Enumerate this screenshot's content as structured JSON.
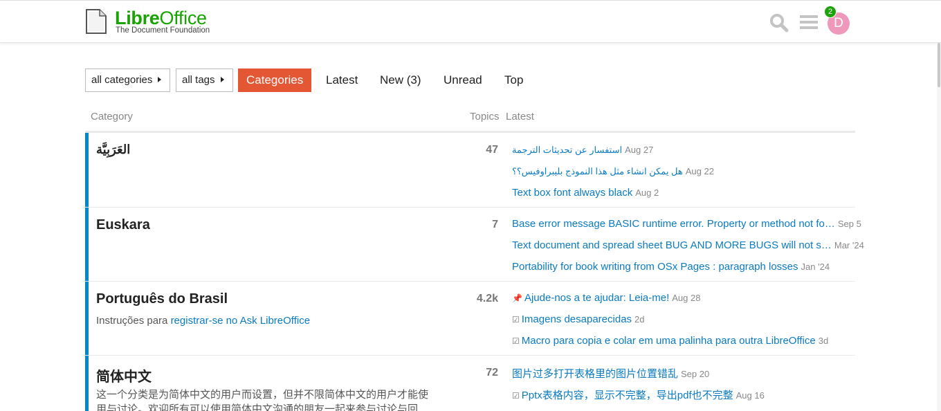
{
  "header": {
    "logo_brand_libre": "Libre",
    "logo_brand_office": "Office",
    "logo_sub": "The Document Foundation",
    "notification_count": "2",
    "avatar_letter": "D"
  },
  "nav": {
    "categories_dropdown": "all categories",
    "tags_dropdown": "all tags",
    "tabs": [
      "Categories",
      "Latest",
      "New (3)",
      "Unread",
      "Top"
    ]
  },
  "table_head": {
    "category": "Category",
    "topics": "Topics",
    "latest": "Latest"
  },
  "categories": [
    {
      "name": "العَرَبِيَّة",
      "count": "47",
      "topics": [
        {
          "title": "استفسار عن تحديثات الترجمة",
          "date": "Aug 27"
        },
        {
          "title": "هل يمكن انشاء مثل هذا النموذج بليبراوفيس؟؟",
          "date": "Aug 22"
        },
        {
          "title": "Text box font always black",
          "date": "Aug 2"
        }
      ]
    },
    {
      "name": "Euskara",
      "count": "7",
      "topics": [
        {
          "title": "Base error message BASIC runtime error. Property or method not fo…",
          "date": "Sep 5"
        },
        {
          "title": "Text document and spread sheet BUG AND MORE BUGS will not s…",
          "date": "Mar '24"
        },
        {
          "title": "Portability for book writing from OSx Pages : paragraph losses",
          "date": "Jan '24"
        }
      ]
    },
    {
      "name": "Português do Brasil",
      "desc_prefix": "Instruções para ",
      "desc_link": "registrar-se no Ask LibreOffice",
      "count": "4.2k",
      "topics": [
        {
          "icon": "pin-icon",
          "title": "Ajude-nos a te ajudar: Leia-me!",
          "date": "Aug 28"
        },
        {
          "icon": "check-icon",
          "title": "Imagens desaparecidas",
          "date": "2d"
        },
        {
          "icon": "check-icon",
          "title": "Macro para copia e colar em uma palinha para outra LibreOffice",
          "date": "3d"
        }
      ]
    },
    {
      "name": "简体中文",
      "desc": "这一个分类是为简体中文的用户而设置，但并不限简体中文的用户才能使用与讨论。欢迎所有可以使用简体中文沟通的朋友一起来参与讨论与回",
      "count": "72",
      "topics": [
        {
          "title": "图片过多打开表格里的图片位置错乱",
          "date": "Sep 20"
        },
        {
          "icon": "check-icon",
          "title": "Pptx表格内容，显示不完整，导出pdf也不完整",
          "date": "Aug 16"
        }
      ]
    }
  ],
  "colors": {
    "brand_green": "#18a303",
    "active_tab": "#e45735",
    "category_bar": "#0088cc",
    "link": "#0a7ac2"
  }
}
